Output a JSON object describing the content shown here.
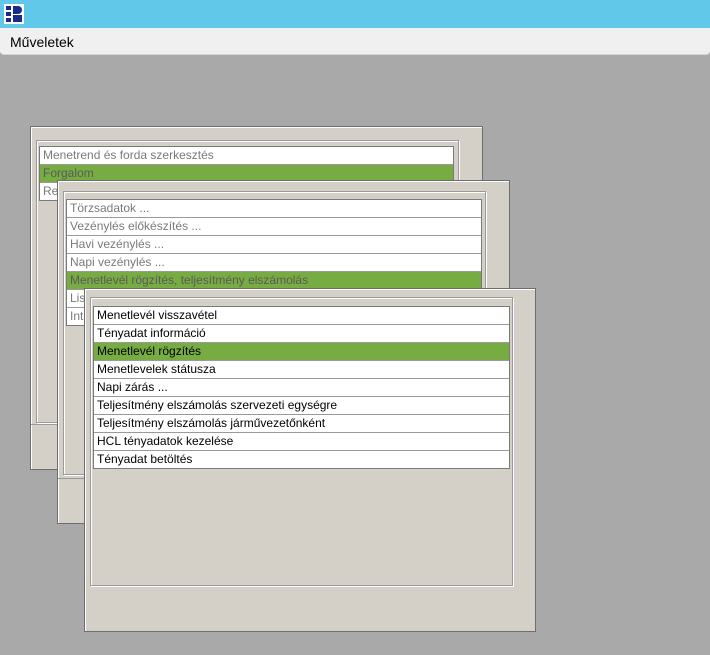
{
  "menubar": {
    "operations_label": "Műveletek"
  },
  "panel1": {
    "items": [
      "Menetrend és forda szerkesztés",
      "Forgalom",
      "Re"
    ],
    "selected_index": 1
  },
  "panel2": {
    "items": [
      "Törzsadatok ...",
      "Vezénylés előkészítés ...",
      "Havi vezénylés ...",
      "Napi vezénylés ...",
      "Menetlevél rögzítés, teljesítmény elszámolás",
      "Lis",
      "Int"
    ],
    "selected_index": 4
  },
  "panel3": {
    "items": [
      "Menetlevél visszavétel",
      "Tényadat információ",
      "Menetlevél rögzítés",
      "Menetlevelek státusza",
      "Napi zárás ...",
      "Teljesítmény elszámolás szervezeti egységre",
      "Teljesítmény elszámolás járművezetőnként",
      "HCL tényadatok kezelése",
      "Tényadat betöltés"
    ],
    "selected_index": 2
  },
  "colors": {
    "selection": "#76ac42",
    "titlebar": "#62c8ea",
    "desktop": "#a9a9a9"
  }
}
